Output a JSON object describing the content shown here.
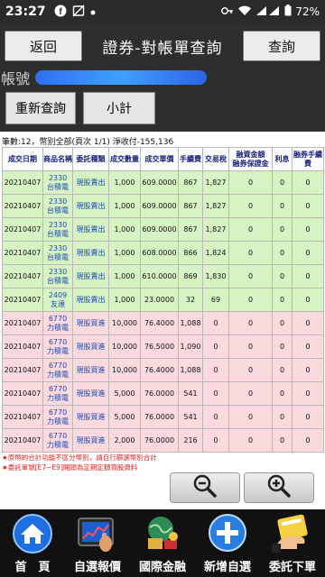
{
  "status_bar": {
    "time": "23:27",
    "battery": "72%",
    "icons": [
      "facebook-icon",
      "no-image-icon",
      "dot-icon",
      "key-icon",
      "wifi-icon",
      "signal-icon",
      "battery-icon"
    ]
  },
  "header": {
    "back_label": "返回",
    "title": "證券-對帳單查詢",
    "query_label": "查詢",
    "account_label": "帳號"
  },
  "actions": {
    "requery_label": "重新查詢",
    "subtotal_label": "小計"
  },
  "summary": "筆數:12，幣別全部(頁次 1/1) 淨收付-155,136",
  "table": {
    "headers": [
      "成交日期",
      "商品名稱",
      "委託種類",
      "成交數量",
      "成交單價",
      "手續費",
      "交易稅",
      "融資金額\n融券保證金",
      "利息",
      "融券手續費"
    ],
    "rows": [
      {
        "date": "20210407",
        "code": "2330",
        "name": "台積電",
        "type": "現股賣出",
        "qty": "1,000",
        "price": "609.0000",
        "fee": "867",
        "tax": "1,827",
        "margin": "0",
        "interest": "0",
        "short_fee": "0",
        "side": "sell"
      },
      {
        "date": "20210407",
        "code": "2330",
        "name": "台積電",
        "type": "現股賣出",
        "qty": "1,000",
        "price": "609.0000",
        "fee": "867",
        "tax": "1,827",
        "margin": "0",
        "interest": "0",
        "short_fee": "0",
        "side": "sell"
      },
      {
        "date": "20210407",
        "code": "2330",
        "name": "台積電",
        "type": "現股賣出",
        "qty": "1,000",
        "price": "609.0000",
        "fee": "867",
        "tax": "1,827",
        "margin": "0",
        "interest": "0",
        "short_fee": "0",
        "side": "sell"
      },
      {
        "date": "20210407",
        "code": "2330",
        "name": "台積電",
        "type": "現股賣出",
        "qty": "1,000",
        "price": "608.0000",
        "fee": "866",
        "tax": "1,824",
        "margin": "0",
        "interest": "0",
        "short_fee": "0",
        "side": "sell"
      },
      {
        "date": "20210407",
        "code": "2330",
        "name": "台積電",
        "type": "現股賣出",
        "qty": "1,000",
        "price": "610.0000",
        "fee": "869",
        "tax": "1,830",
        "margin": "0",
        "interest": "0",
        "short_fee": "0",
        "side": "sell"
      },
      {
        "date": "20210407",
        "code": "2409",
        "name": "友達",
        "type": "現股賣出",
        "qty": "1,000",
        "price": "23.0000",
        "fee": "32",
        "tax": "69",
        "margin": "0",
        "interest": "0",
        "short_fee": "0",
        "side": "sell"
      },
      {
        "date": "20210407",
        "code": "6770",
        "name": "力積電",
        "type": "現股買進",
        "qty": "10,000",
        "price": "76.4000",
        "fee": "1,088",
        "tax": "0",
        "margin": "0",
        "interest": "0",
        "short_fee": "0",
        "side": "buy"
      },
      {
        "date": "20210407",
        "code": "6770",
        "name": "力積電",
        "type": "現股買進",
        "qty": "10,000",
        "price": "76.5000",
        "fee": "1,090",
        "tax": "0",
        "margin": "0",
        "interest": "0",
        "short_fee": "0",
        "side": "buy"
      },
      {
        "date": "20210407",
        "code": "6770",
        "name": "力積電",
        "type": "現股買進",
        "qty": "10,000",
        "price": "76.4000",
        "fee": "1,088",
        "tax": "0",
        "margin": "0",
        "interest": "0",
        "short_fee": "0",
        "side": "buy"
      },
      {
        "date": "20210407",
        "code": "6770",
        "name": "力積電",
        "type": "現股買進",
        "qty": "5,000",
        "price": "76.0000",
        "fee": "541",
        "tax": "0",
        "margin": "0",
        "interest": "0",
        "short_fee": "0",
        "side": "buy"
      },
      {
        "date": "20210407",
        "code": "6770",
        "name": "力積電",
        "type": "現股買進",
        "qty": "5,000",
        "price": "76.0000",
        "fee": "541",
        "tax": "0",
        "margin": "0",
        "interest": "0",
        "short_fee": "0",
        "side": "buy"
      },
      {
        "date": "20210407",
        "code": "6770",
        "name": "力積電",
        "type": "現股買進",
        "qty": "2,000",
        "price": "76.0000",
        "fee": "216",
        "tax": "0",
        "margin": "0",
        "interest": "0",
        "short_fee": "0",
        "side": "buy"
      }
    ]
  },
  "notes": [
    "★原幣的合計功能不區分幣別，請自行篩選幣別合計",
    "★委託單號[E7~E9]開頭為定期定額買股資料"
  ],
  "zoom": {
    "out_icon": "zoom-out-icon",
    "in_icon": "zoom-in-icon"
  },
  "bottom_nav": [
    {
      "label": "首　頁",
      "icon": "home-icon"
    },
    {
      "label": "自選報價",
      "icon": "tablet-quote-icon"
    },
    {
      "label": "國際金融",
      "icon": "globe-money-icon"
    },
    {
      "label": "新增自選",
      "icon": "plus-icon"
    },
    {
      "label": "委託下單",
      "icon": "hand-order-icon"
    }
  ],
  "colors": {
    "sell_row": "#d8f3c3",
    "buy_row": "#fadadd",
    "header_bg": "#2e2e2e",
    "link_blue": "#1a49b5",
    "note_red": "#e02020"
  }
}
